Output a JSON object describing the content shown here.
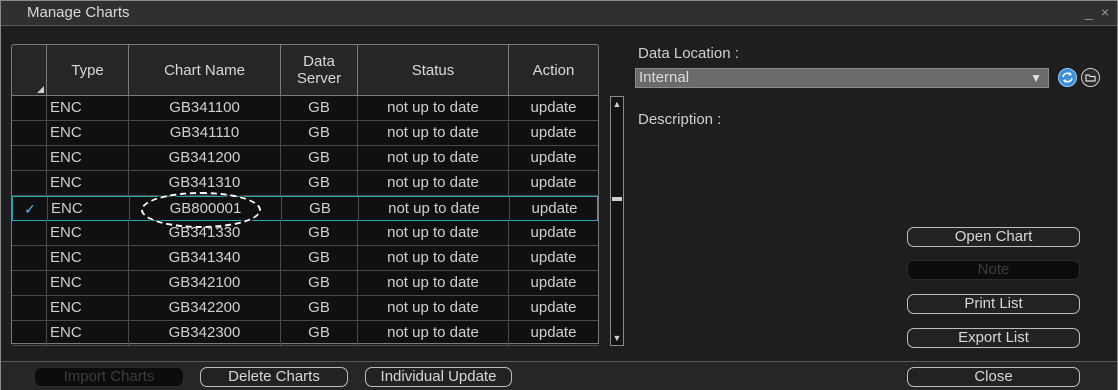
{
  "window": {
    "title": "Manage Charts",
    "controls": "_ ×"
  },
  "table": {
    "columns": [
      "Type",
      "Chart Name",
      "Data\nServer",
      "Status",
      "Action"
    ],
    "rows": [
      {
        "check": "",
        "type": "ENC",
        "name": "GB341100",
        "server": "GB",
        "status": "not up to date",
        "action": "update"
      },
      {
        "check": "",
        "type": "ENC",
        "name": "GB341110",
        "server": "GB",
        "status": "not up to date",
        "action": "update"
      },
      {
        "check": "",
        "type": "ENC",
        "name": "GB341200",
        "server": "GB",
        "status": "not up to date",
        "action": "update"
      },
      {
        "check": "",
        "type": "ENC",
        "name": "GB341310",
        "server": "GB",
        "status": "not up to date",
        "action": "update"
      },
      {
        "check": "✓",
        "type": "ENC",
        "name": "GB800001",
        "server": "GB",
        "status": "not up to date",
        "action": "update",
        "selected": true
      },
      {
        "check": "",
        "type": "ENC",
        "name": "GB341330",
        "server": "GB",
        "status": "not up to date",
        "action": "update"
      },
      {
        "check": "",
        "type": "ENC",
        "name": "GB341340",
        "server": "GB",
        "status": "not up to date",
        "action": "update"
      },
      {
        "check": "",
        "type": "ENC",
        "name": "GB342100",
        "server": "GB",
        "status": "not up to date",
        "action": "update"
      },
      {
        "check": "",
        "type": "ENC",
        "name": "GB342200",
        "server": "GB",
        "status": "not up to date",
        "action": "update"
      },
      {
        "check": "",
        "type": "ENC",
        "name": "GB342300",
        "server": "GB",
        "status": "not up to date",
        "action": "update"
      }
    ]
  },
  "right_panel": {
    "data_location_label": "Data Location :",
    "data_location_value": "Internal",
    "description_label": "Description :",
    "buttons": {
      "open_chart": "Open Chart",
      "note": "Note",
      "print_list": "Print List",
      "export_list": "Export List"
    }
  },
  "bottom": {
    "import_charts": "Import Charts",
    "delete_charts": "Delete Charts",
    "individual_update": "Individual Update",
    "close": "Close"
  },
  "icons": {
    "refresh": "refresh-icon",
    "folder": "folder-icon"
  },
  "colors": {
    "selection": "#2aa8b8",
    "check": "#4ab8ff",
    "refresh": "#3a8fd8"
  }
}
